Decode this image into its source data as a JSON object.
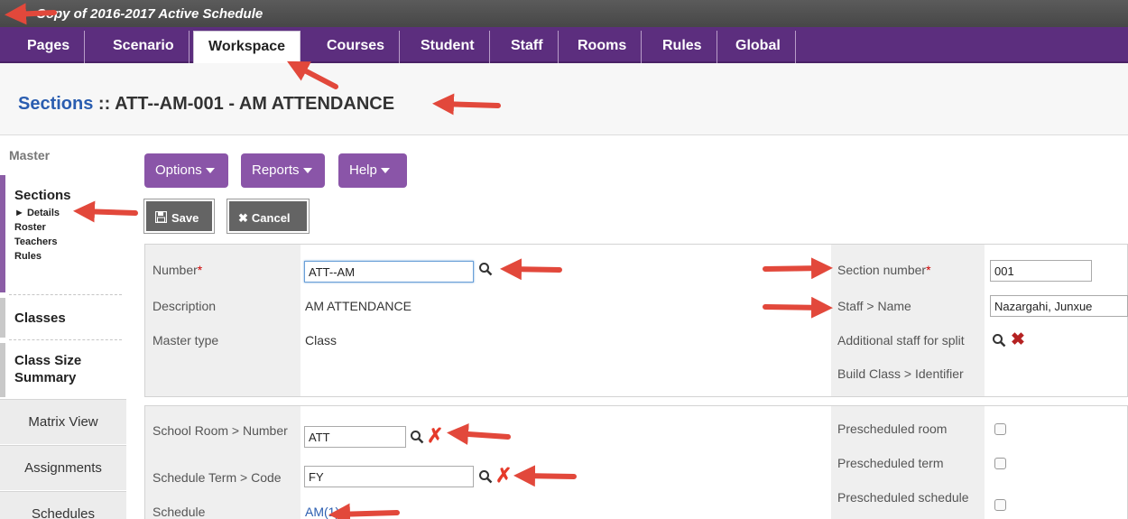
{
  "window": {
    "title": "Copy of 2016-2017 Active Schedule"
  },
  "tabs": [
    "Pages",
    "Scenario",
    "Workspace",
    "Courses",
    "Student",
    "Staff",
    "Rooms",
    "Rules",
    "Global"
  ],
  "header": {
    "sections_link": "Sections",
    "separator": " :: ",
    "record": "ATT--AM-001 - AM ATTENDANCE"
  },
  "sidebar": {
    "master": "Master",
    "sections": "Sections",
    "sections_items": [
      "Details",
      "Roster",
      "Teachers",
      "Rules"
    ],
    "classes": "Classes",
    "class_size_summary": "Class Size Summary",
    "matrix_view": "Matrix View",
    "assignments": "Assignments",
    "schedules": "Schedules"
  },
  "toolbar": {
    "options": "Options",
    "reports": "Reports",
    "help": "Help",
    "save": "Save",
    "cancel": "Cancel"
  },
  "form": {
    "number_label": "Number",
    "number_value": "ATT--AM",
    "description_label": "Description",
    "description_value": "AM ATTENDANCE",
    "master_type_label": "Master type",
    "master_type_value": "Class",
    "section_number_label": "Section number",
    "section_number_value": "001",
    "staff_name_label": "Staff > Name",
    "staff_name_value": "Nazargahi, Junxue",
    "additional_staff_label": "Additional staff for split",
    "build_class_label": "Build Class > Identifier",
    "school_room_label": "School Room > Number",
    "school_room_value": "ATT",
    "schedule_term_label": "Schedule Term > Code",
    "schedule_term_value": "FY",
    "schedule_label": "Schedule",
    "schedule_value": "AM(1)",
    "prescheduled_room_label": "Prescheduled room",
    "prescheduled_term_label": "Prescheduled term",
    "prescheduled_schedule_label": "Prescheduled schedule"
  },
  "colors": {
    "brand_purple": "#5c2e7e",
    "button_purple": "#8a55a8",
    "annotation_red": "#e2483b",
    "link_blue": "#2a5db0"
  }
}
